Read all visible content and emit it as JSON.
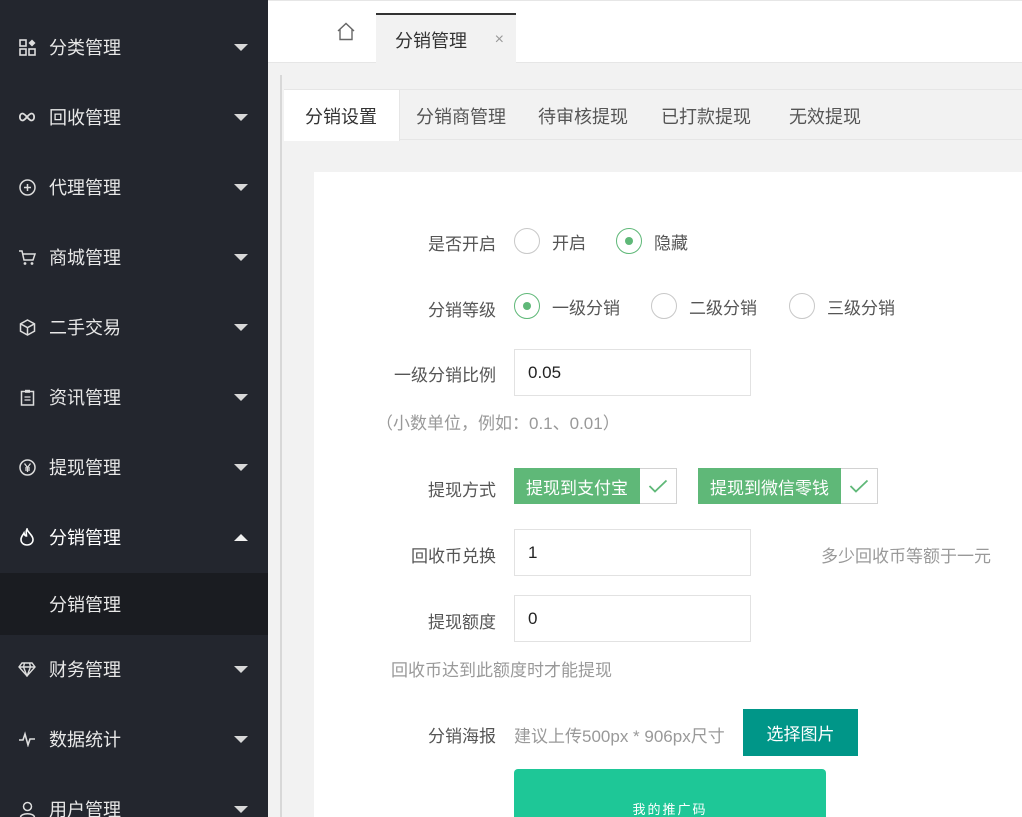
{
  "sidebar": {
    "items": [
      {
        "label": "分类管理",
        "icon": "grid-icon"
      },
      {
        "label": "回收管理",
        "icon": "infinity-icon"
      },
      {
        "label": "代理管理",
        "icon": "plus-circle-icon"
      },
      {
        "label": "商城管理",
        "icon": "cart-icon"
      },
      {
        "label": "二手交易",
        "icon": "cube-icon"
      },
      {
        "label": "资讯管理",
        "icon": "clipboard-icon"
      },
      {
        "label": "提现管理",
        "icon": "yen-circle-icon"
      },
      {
        "label": "分销管理",
        "icon": "flame-icon"
      },
      {
        "label": "财务管理",
        "icon": "diamond-icon"
      },
      {
        "label": "数据统计",
        "icon": "pulse-icon"
      },
      {
        "label": "用户管理",
        "icon": "user-icon"
      }
    ],
    "sub_item": "分销管理"
  },
  "topbar": {
    "home_icon": "home-icon",
    "tab_label": "分销管理",
    "close_label": "×"
  },
  "tabs": [
    "分销设置",
    "分销商管理",
    "待审核提现",
    "已打款提现",
    "无效提现"
  ],
  "form": {
    "enable": {
      "label": "是否开启",
      "options": [
        "开启",
        "隐藏"
      ],
      "selected": "隐藏"
    },
    "level": {
      "label": "分销等级",
      "options": [
        "一级分销",
        "二级分销",
        "三级分销"
      ],
      "selected": "一级分销"
    },
    "ratio": {
      "label": "一级分销比例",
      "value": "0.05",
      "hint": "（小数单位，例如：0.1、0.01）"
    },
    "withdraw_method": {
      "label": "提现方式",
      "options": [
        "提现到支付宝",
        "提现到微信零钱"
      ],
      "checked": [
        true,
        true
      ]
    },
    "coin_exchange": {
      "label": "回收币兑换",
      "value": "1",
      "hint": "多少回收币等额于一元"
    },
    "withdraw_limit": {
      "label": "提现额度",
      "value": "0",
      "hint": "回收币达到此额度时才能提现"
    },
    "poster": {
      "label": "分销海报",
      "hint": "建议上传500px * 906px尺寸",
      "button": "选择图片",
      "preview_text": "我的推广码"
    }
  },
  "colors": {
    "sidebar_bg": "#23262e",
    "accent_green": "#5fb878",
    "button_teal": "#009688",
    "poster_green": "#1ec797"
  }
}
